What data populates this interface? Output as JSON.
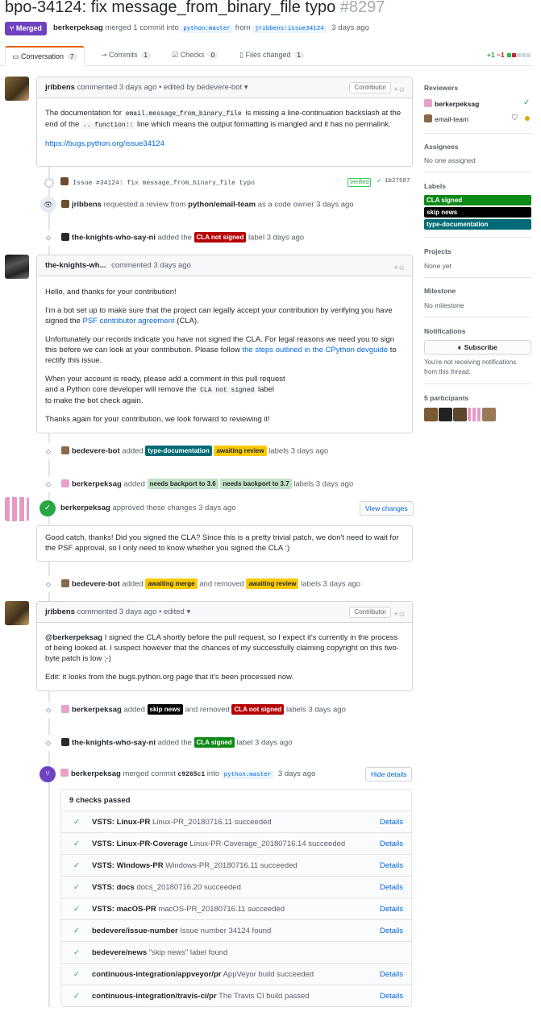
{
  "header": {
    "title": "bpo-34124: fix message_from_binary_file typo",
    "number": "#8297",
    "status": "Merged",
    "author": "berkerpeksag",
    "merged_text": "merged 1 commit into",
    "base_branch": "python:master",
    "from_text": "from",
    "head_branch": "jribbens:issue34124",
    "time": "3 days ago"
  },
  "tabs": [
    {
      "label": "Conversation",
      "count": "7"
    },
    {
      "label": "Commits",
      "count": "1"
    },
    {
      "label": "Checks",
      "count": "0"
    },
    {
      "label": "Files changed",
      "count": "1"
    }
  ],
  "diffstat": {
    "add": "+1",
    "del": "−1"
  },
  "c1": {
    "author": "jribbens",
    "meta": "commented 3 days ago • edited by bedevere-bot ▾",
    "badge": "Contributor",
    "p1a": "The documentation for",
    "p1code": "email.message_from_binary_file",
    "p1b": "is missing a line-continuation backslash at the end of the",
    "p1code2": ".. function::",
    "p1c": "line which means the output formatting is mangled and it has no permalink.",
    "link": "https://bugs.python.org/issue34124"
  },
  "commit": {
    "message": "Issue #34124: fix message_from_binary_file typo",
    "verified": "Verified",
    "sha": "1b27587"
  },
  "e1": {
    "actor": "jribbens",
    "a": "requested a review from",
    "team": "python/email-team",
    "b": "as a code owner 3 days ago"
  },
  "e2": {
    "actor": "the-knights-who-say-ni",
    "a": "added the",
    "label": "CLA not signed",
    "b": "label 3 days ago"
  },
  "c2": {
    "author": "the-knights-wh...",
    "meta": "commented 3 days ago",
    "p1": "Hello, and thanks for your contribution!",
    "p2a": "I'm a bot set up to make sure that the project can legally accept your contribution by verifying you have signed the",
    "p2link": "PSF contributor agreement",
    "p2b": "(CLA).",
    "p3a": "Unfortunately our records indicate you have not signed the CLA. For legal reasons we need you to sign this before we can look at your contribution. Please follow",
    "p3link": "the steps outlined in the CPython devguide",
    "p3b": "to rectify this issue.",
    "p4a": "When your account is ready, please add a comment in this pull request",
    "p4b": "and a Python core developer will remove the",
    "p4code": "CLA not signed",
    "p4c": "label",
    "p4d": "to make the bot check again.",
    "p5": "Thanks again for your contribution, we look forward to reviewing it!"
  },
  "e3": {
    "actor": "bedevere-bot",
    "a": "added",
    "label1": "type-documentation",
    "label2": "awaiting review",
    "b": "labels 3 days ago"
  },
  "e4": {
    "actor": "berkerpeksag",
    "a": "added",
    "label1": "needs backport to 3.6",
    "label2": "needs backport to 3.7",
    "b": "labels 3 days ago"
  },
  "review": {
    "actor": "berkerpeksag",
    "text": "approved these changes 3 days ago",
    "button": "View changes",
    "body": "Good catch, thanks! Did you signed the CLA? Since this is a pretty trivial patch, we don't need to wait for the PSF approval, so I only need to know whether you signed the CLA :)"
  },
  "e5": {
    "actor": "bedevere-bot",
    "a": "added",
    "label1": "awaiting merge",
    "mid": "and removed",
    "label2": "awaiting review",
    "b": "labels 3 days ago"
  },
  "c3": {
    "author": "jribbens",
    "meta": "commented 3 days ago • edited ▾",
    "badge": "Contributor",
    "mention": "@berkerpeksag",
    "p1": "I signed the CLA shortly before the pull request, so I expect it's currently in the process of being looked at. I suspect however that the chances of my successfully claiming copyright on this two-byte patch is low ;-)",
    "p2": "Edit: it looks from the bugs.python.org page that it's been processed now."
  },
  "e6": {
    "actor": "berkerpeksag",
    "a": "added",
    "label1": "skip news",
    "mid": "and removed",
    "label2": "CLA not signed",
    "b": "labels 3 days ago"
  },
  "e7": {
    "actor": "the-knights-who-say-ni",
    "a": "added the",
    "label": "CLA signed",
    "b": "label 3 days ago"
  },
  "merge": {
    "actor": "berkerpeksag",
    "a": "merged commit",
    "sha": "c9265c1",
    "b": "into",
    "branch": "python:master",
    "time": "3 days ago",
    "button": "Hide details"
  },
  "checks": {
    "header": "9 checks passed",
    "rows": [
      {
        "name": "VSTS: Linux-PR",
        "desc": "Linux-PR_20180716.11 succeeded",
        "details": "Details"
      },
      {
        "name": "VSTS: Linux-PR-Coverage",
        "desc": "Linux-PR-Coverage_20180716.14 succeeded",
        "details": "Details"
      },
      {
        "name": "VSTS: Windows-PR",
        "desc": "Windows-PR_20180716.11 succeeded",
        "details": "Details"
      },
      {
        "name": "VSTS: docs",
        "desc": "docs_20180716.20 succeeded",
        "details": "Details"
      },
      {
        "name": "VSTS: macOS-PR",
        "desc": "macOS-PR_20180716.11 succeeded",
        "details": "Details"
      },
      {
        "name": "bedevere/issue-number",
        "desc": "Issue number 34124 found",
        "details": "Details"
      },
      {
        "name": "bedevere/news",
        "desc": "\"skip news\" label found",
        "details": ""
      },
      {
        "name": "continuous-integration/appveyor/pr",
        "desc": "AppVeyor build succeeded",
        "details": "Details"
      },
      {
        "name": "continuous-integration/travis-ci/pr",
        "desc": "The Travis CI build passed",
        "details": "Details"
      }
    ]
  },
  "sidebar": {
    "reviewers_title": "Reviewers",
    "reviewer1": "berkerpeksag",
    "reviewer2": "email-team",
    "assignees_title": "Assignees",
    "assignees_value": "No one assigned",
    "labels_title": "Labels",
    "labels": [
      "CLA signed",
      "skip news",
      "type-documentation"
    ],
    "projects_title": "Projects",
    "projects_value": "None yet",
    "milestone_title": "Milestone",
    "milestone_value": "No milestone",
    "notifications_title": "Notifications",
    "subscribe": "Subscribe",
    "notif_text1": "You're not receiving notifications",
    "notif_text2": "from this thread.",
    "participants_title": "5 participants"
  },
  "colors": {
    "merged": "#6f42c1",
    "cla_not_signed": "#b60205",
    "cla_signed": "#0e8a16",
    "type_doc": "#006b75",
    "awaiting": "#fbca04"
  }
}
